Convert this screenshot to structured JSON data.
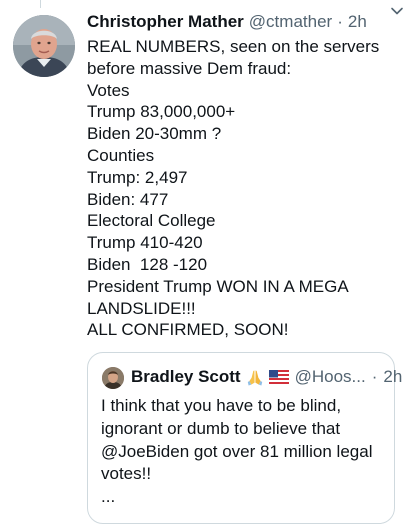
{
  "tweet": {
    "author_name": "Christopher Mather",
    "author_handle": "@ctmather",
    "timestamp": "2h",
    "text_lines": [
      "REAL NUMBERS, seen on the servers",
      "before massive Dem fraud:",
      "Votes",
      "Trump 83,000,000+",
      "Biden 20-30mm ?",
      "Counties",
      "Trump: 2,497",
      "Biden: 477",
      "Electoral College",
      "Trump 410-420",
      "Biden  128 -120",
      "President Trump WON IN A MEGA",
      "LANDSLIDE!!!",
      "ALL CONFIRMED, SOON!"
    ]
  },
  "quoted_tweet": {
    "author_name": "Bradley Scott",
    "emojis": [
      "praying-hands-emoji",
      "us-flag-emoji"
    ],
    "author_handle": "@Hoos...",
    "timestamp": "2h",
    "text_lines": [
      "I think that you have to be blind,",
      "ignorant or dumb to believe that",
      "@JoeBiden got over 81 million legal",
      "votes!!",
      "..."
    ]
  },
  "colors": {
    "text_primary": "#0f1419",
    "text_secondary": "#536471",
    "border": "#cfd9de"
  }
}
